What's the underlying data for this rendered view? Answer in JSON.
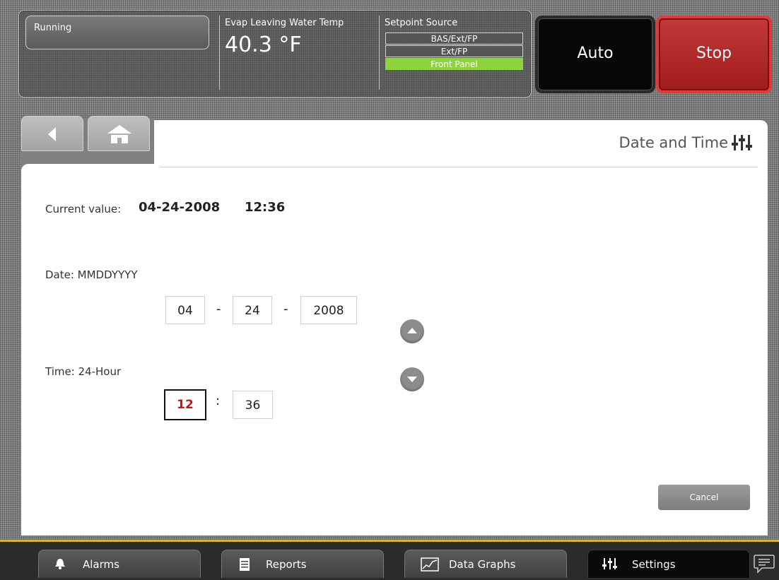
{
  "header": {
    "status": "Running",
    "temp_label": "Evap Leaving Water Temp",
    "temp_value": "40.3 °F",
    "setpoint_label": "Setpoint Source",
    "setpoint_options": [
      "BAS/Ext/FP",
      "Ext/FP",
      "Front Panel"
    ],
    "setpoint_active_index": 2,
    "auto_label": "Auto",
    "stop_label": "Stop"
  },
  "page": {
    "title": "Date and Time",
    "current_label": "Current value:",
    "current_date": "04-24-2008",
    "current_time": "12:36",
    "date_label": "Date: MMDDYYYY",
    "date_month": "04",
    "date_day": "24",
    "date_year": "2008",
    "date_sep": "-",
    "time_label": "Time: 24-Hour",
    "time_hour": "12",
    "time_minute": "36",
    "time_sep": ":",
    "cancel_label": "Cancel"
  },
  "footer": {
    "alarms": "Alarms",
    "reports": "Reports",
    "data_graphs": "Data Graphs",
    "settings": "Settings"
  },
  "colors": {
    "stop_red": "#b52727",
    "active_green": "#8dd33d",
    "selected_red": "#d01010",
    "footer_accent": "#d9b341"
  },
  "icons": [
    "back-arrow-icon",
    "home-icon",
    "settings-sliders-icon",
    "up-arrow-icon",
    "down-arrow-icon",
    "bell-icon",
    "document-icon",
    "chart-icon",
    "chat-icon"
  ]
}
